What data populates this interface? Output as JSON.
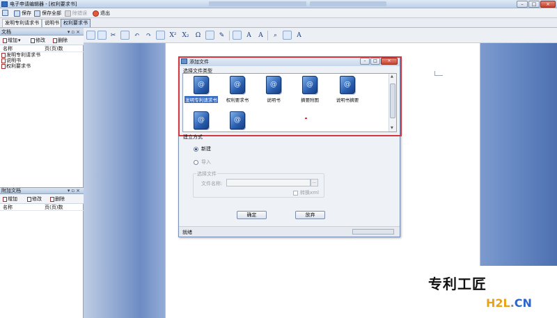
{
  "window": {
    "title": "电子申请编辑器 - [权利要求书]",
    "app_icon": "app-icon"
  },
  "menubar": {
    "save": "保存",
    "save_all": "保存全部",
    "signature": "除错误",
    "exit": "退出"
  },
  "doc_tabs": [
    "发明专利请求书",
    "说明书",
    "权利要求书"
  ],
  "active_tab": "权利要求书",
  "documents_panel": {
    "title": "文档",
    "buttons": {
      "add": "增加",
      "edit": "修改",
      "delete": "删除"
    },
    "columns": {
      "name": "名称",
      "pages": "页(页)数"
    },
    "items": [
      "发明专利请求书",
      "说明书",
      "权利要求书"
    ]
  },
  "attachments_panel": {
    "title": "附加文档",
    "buttons": {
      "add": "增加",
      "edit": "修改",
      "delete": "删除"
    },
    "columns": {
      "name": "名称",
      "pages": "页(页)数"
    }
  },
  "toolbar_icons": [
    "layout-icon",
    "format-icon",
    "cut-icon",
    "copy-icon",
    "undo-icon",
    "redo-icon",
    "insert-table-icon",
    "superscript-icon",
    "subscript-icon",
    "omega-icon",
    "image-icon",
    "tool-icon",
    "frame-icon",
    "font-a-icon",
    "font-a-plus-icon",
    "zoom-icon",
    "print-icon",
    "font-settings-icon"
  ],
  "toolbar_glyphs": {
    "superscript": "X²",
    "subscript": "X₂",
    "omega": "Ω",
    "font_a": "A"
  },
  "dialog": {
    "title": "添加文件",
    "file_type_label": "选择文件类型",
    "file_types": [
      "发明专利请求书",
      "权利要求书",
      "说明书",
      "摘要附图",
      "说明书摘要",
      "",
      ""
    ],
    "selected_index": 0,
    "mode_label": "建立方式",
    "mode_new": "新建",
    "mode_import": "导入",
    "choose_file_label": "选择文件",
    "file_name_label": "文件名称:",
    "browse_label": "...",
    "convert_xml": "转换xml",
    "ok_button": "确定",
    "cancel_button": "放弃",
    "status": "就绪"
  },
  "watermark": {
    "text": "专利工匠",
    "site": "H2L.CN",
    "site_h": "H2L",
    "site_dot": ".",
    "site_cn": "CN"
  },
  "colors": {
    "highlight_outline": "#d2363f",
    "selection": "#3c6fc4",
    "site_h2l": "#e8a21a",
    "site_cn": "#2d64c8"
  }
}
